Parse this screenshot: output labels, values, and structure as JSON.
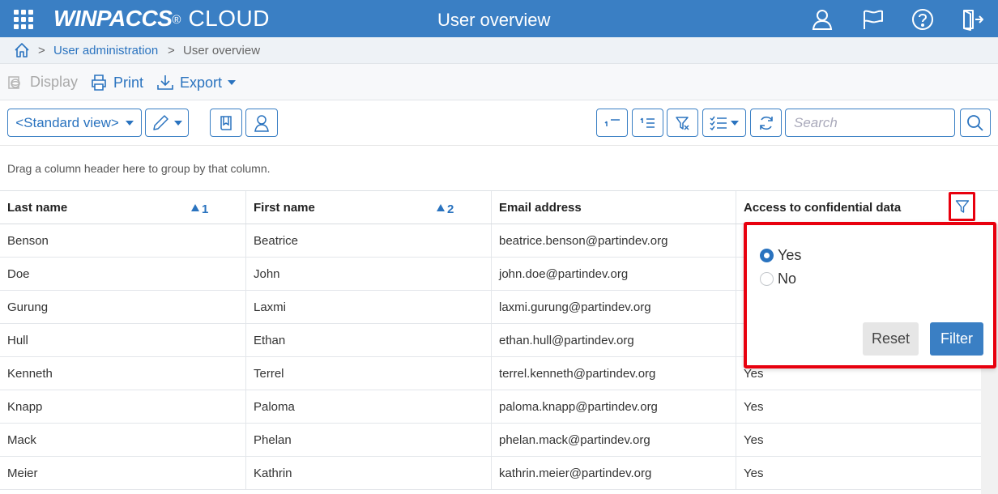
{
  "app": {
    "brand_bold": "WINPACCS",
    "brand_reg": "®",
    "brand_light": "CLOUD",
    "title": "User overview"
  },
  "breadcrumb": {
    "separator": ">",
    "link": "User administration",
    "current": "User overview"
  },
  "toolbar": {
    "display_label": "Display",
    "print_label": "Print",
    "export_label": "Export"
  },
  "filterbar": {
    "view_label": "<Standard view>",
    "search_placeholder": "Search"
  },
  "grouping_hint": "Drag a column header here to group by that column.",
  "table": {
    "columns": [
      {
        "label": "Last name",
        "sort_order": "1"
      },
      {
        "label": "First name",
        "sort_order": "2"
      },
      {
        "label": "Email address",
        "sort_order": ""
      },
      {
        "label": "Access to confidential data",
        "sort_order": ""
      }
    ],
    "rows": [
      {
        "last": "Benson",
        "first": "Beatrice",
        "email": "beatrice.benson@partindev.org",
        "access": ""
      },
      {
        "last": "Doe",
        "first": "John",
        "email": "john.doe@partindev.org",
        "access": ""
      },
      {
        "last": "Gurung",
        "first": "Laxmi",
        "email": "laxmi.gurung@partindev.org",
        "access": ""
      },
      {
        "last": "Hull",
        "first": "Ethan",
        "email": "ethan.hull@partindev.org",
        "access": ""
      },
      {
        "last": "Kenneth",
        "first": "Terrel",
        "email": "terrel.kenneth@partindev.org",
        "access": "Yes"
      },
      {
        "last": "Knapp",
        "first": "Paloma",
        "email": "paloma.knapp@partindev.org",
        "access": "Yes"
      },
      {
        "last": "Mack",
        "first": "Phelan",
        "email": "phelan.mack@partindev.org",
        "access": "Yes"
      },
      {
        "last": "Meier",
        "first": "Kathrin",
        "email": "kathrin.meier@partindev.org",
        "access": "Yes"
      }
    ]
  },
  "filter_popup": {
    "options": [
      {
        "label": "Yes",
        "selected": true
      },
      {
        "label": "No",
        "selected": false
      }
    ],
    "reset_label": "Reset",
    "filter_label": "Filter"
  },
  "colors": {
    "primary": "#3a7fc4",
    "highlight": "#e8000e"
  }
}
